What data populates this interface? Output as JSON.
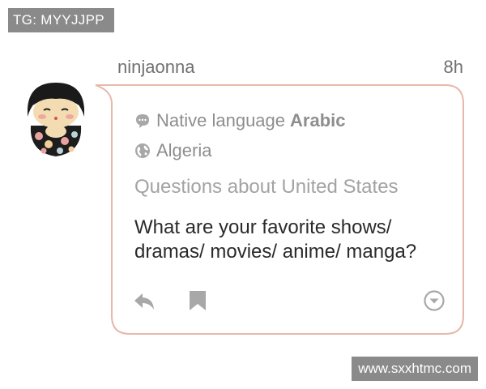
{
  "watermarks": {
    "top_left": "TG: MYYJJPP",
    "bottom_right": "www.sxxhtmc.com"
  },
  "post": {
    "username": "ninjaonna",
    "time": "8h",
    "native_language_label": "Native language",
    "native_language": "Arabic",
    "location": "Algeria",
    "topic": "Questions about United States",
    "question": "What are your favorite shows/ dramas/ movies/ anime/ manga?"
  },
  "icons": {
    "language": "speech-bubble-icon",
    "location": "globe-icon",
    "reply": "reply-icon",
    "bookmark": "bookmark-icon",
    "more": "chevron-down-circle-icon"
  },
  "colors": {
    "bubble_border": "#e7b8ab",
    "icon_gray": "#a8a8a8",
    "text_dark": "#2a2a2a",
    "text_gray": "#8e8e8e"
  }
}
